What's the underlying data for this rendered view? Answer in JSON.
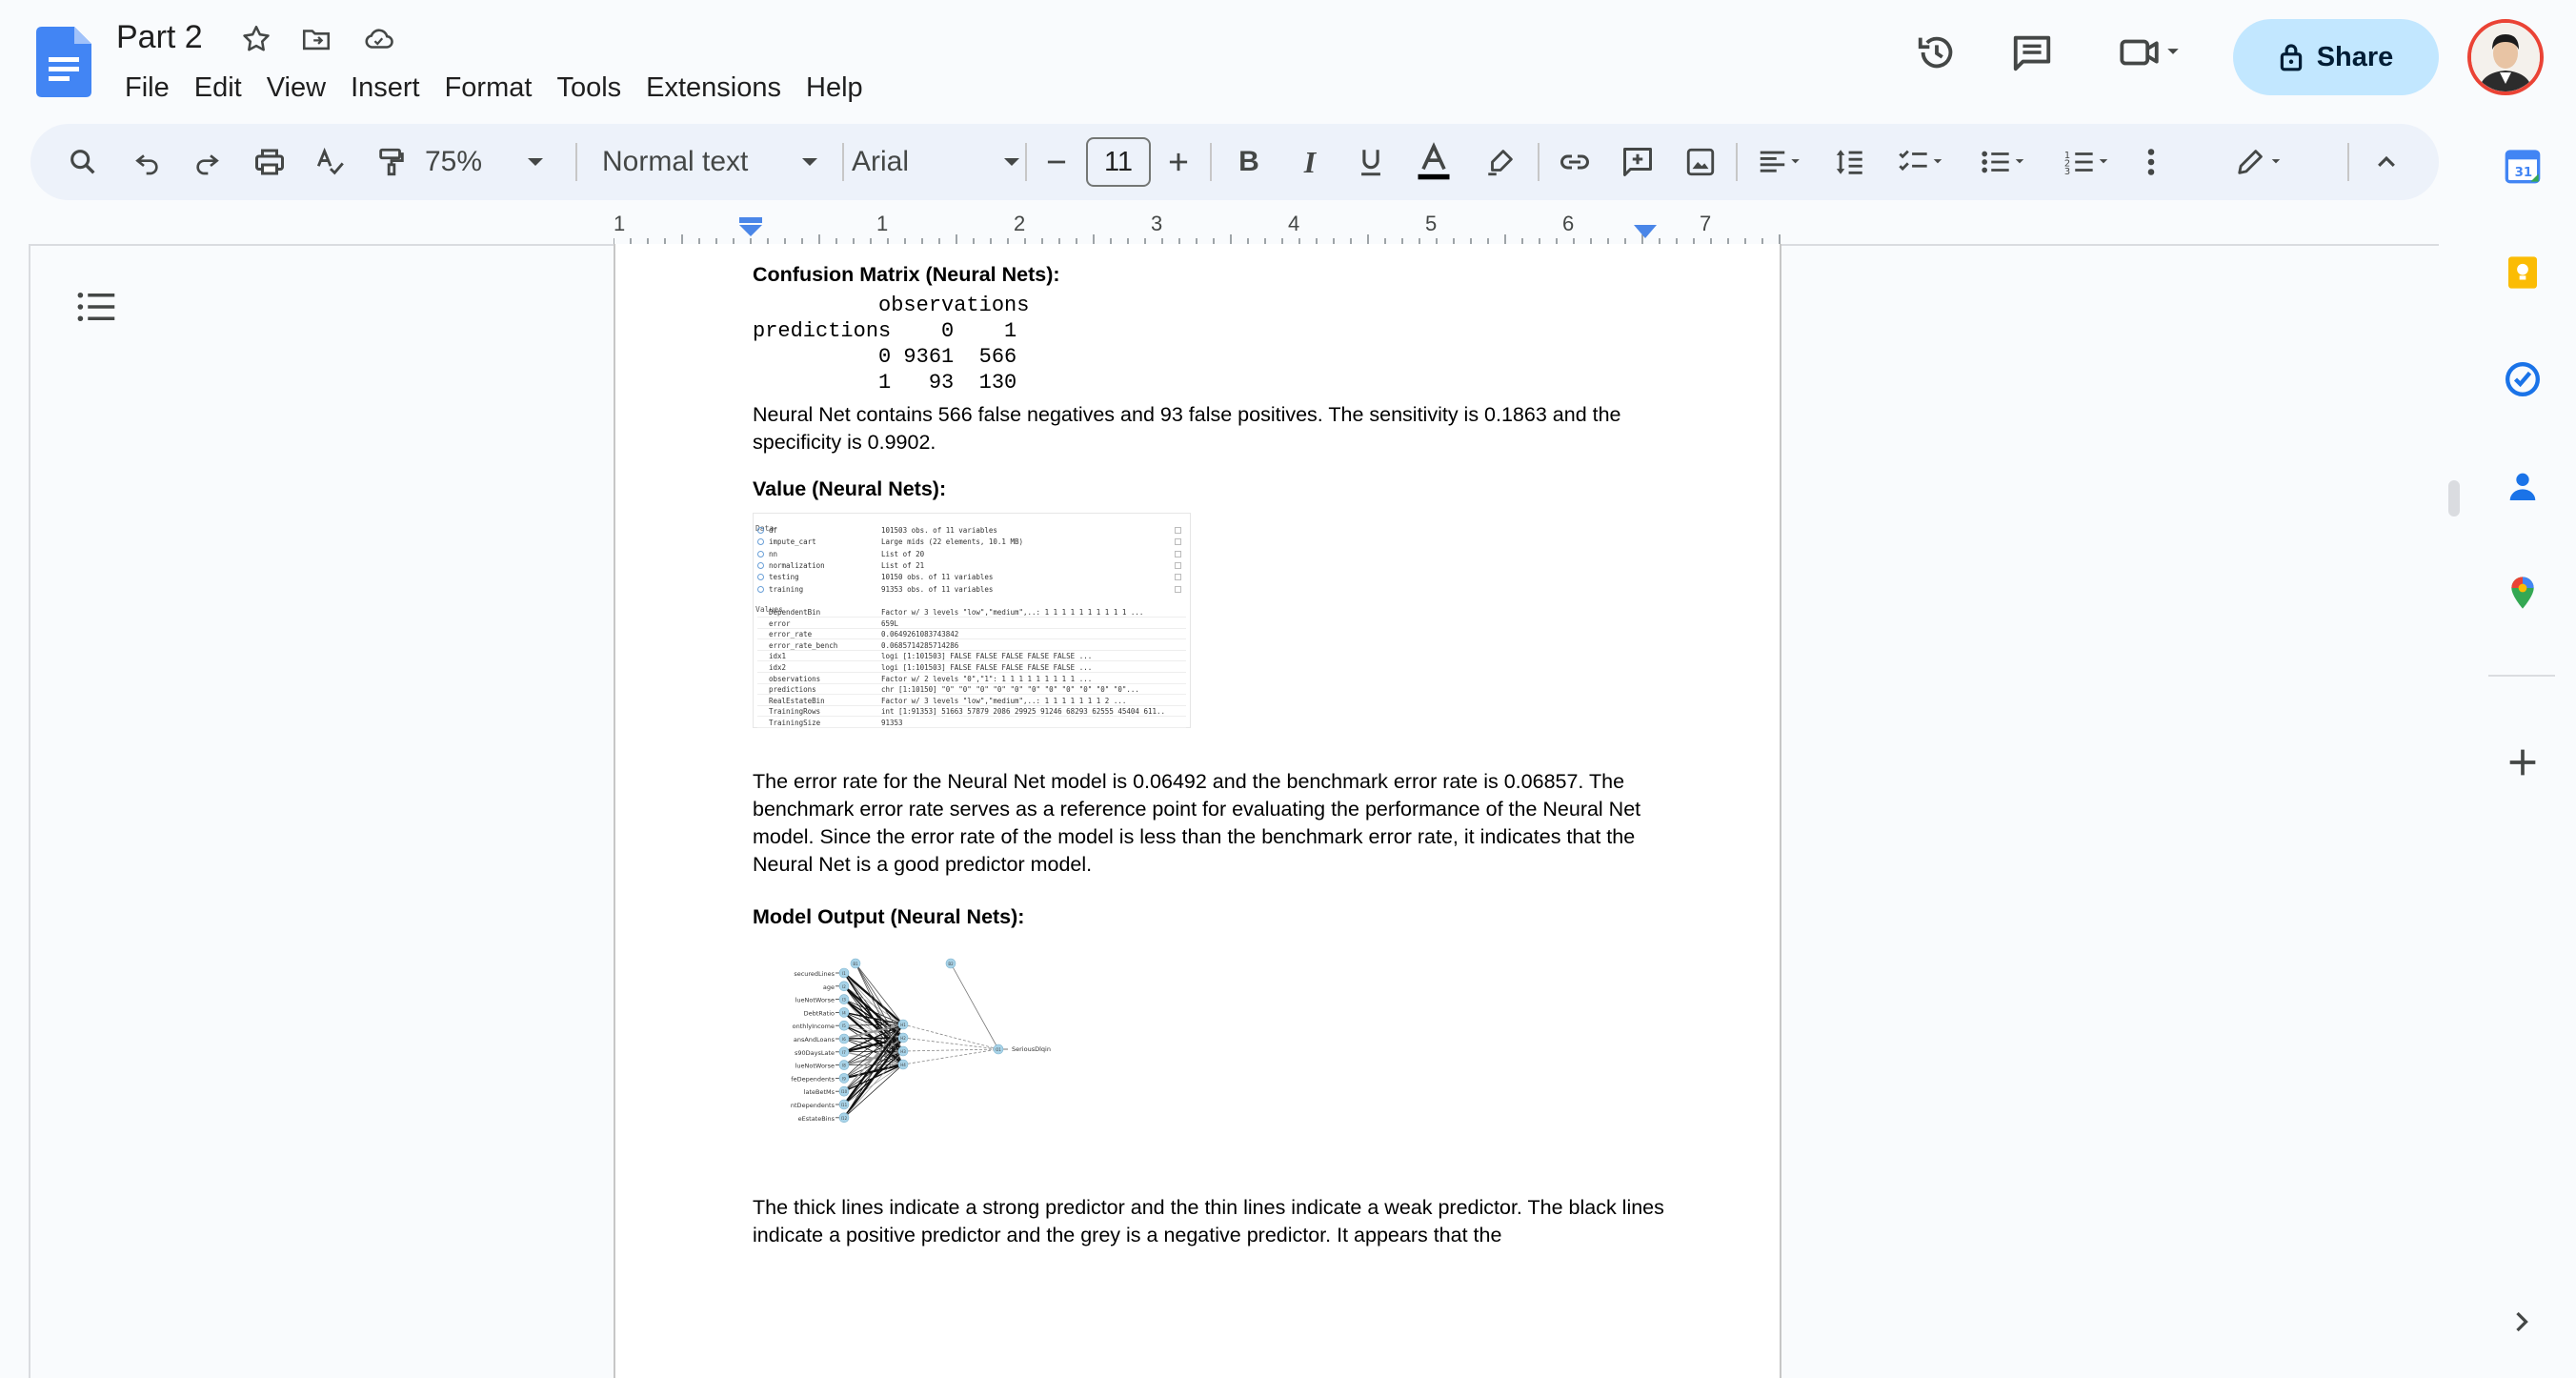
{
  "doc": {
    "title": "Part 2"
  },
  "menu": [
    "File",
    "Edit",
    "View",
    "Insert",
    "Format",
    "Tools",
    "Extensions",
    "Help"
  ],
  "share": {
    "label": "Share"
  },
  "toolbar": {
    "zoom": "75%",
    "style": "Normal text",
    "font": "Arial",
    "font_size": "11"
  },
  "ruler": {
    "numbers": [
      "1",
      "1",
      "2",
      "3",
      "4",
      "5",
      "6",
      "7"
    ]
  },
  "content": {
    "h1": "Confusion Matrix (Neural Nets):",
    "matrix_lines": [
      "          observations",
      "predictions    0    1",
      "          0 9361  566",
      "          1   93  130"
    ],
    "p1": "Neural Net contains 566 false negatives and 93 false positives. The sensitivity is 0.1863 and the specificity is 0.9902.",
    "h2": "Value (Neural Nets):",
    "env": {
      "data_header": "Data",
      "data_rows": [
        {
          "k": "df",
          "v": "101503 obs. of 11 variables"
        },
        {
          "k": "impute_cart",
          "v": "Large mids (22 elements,  10.1 MB)"
        },
        {
          "k": "nn",
          "v": "List of  20"
        },
        {
          "k": "normalization",
          "v": "List of  21"
        },
        {
          "k": "testing",
          "v": "10150 obs. of 11 variables"
        },
        {
          "k": "training",
          "v": "91353 obs. of 11 variables"
        }
      ],
      "values_header": "Values",
      "value_rows": [
        {
          "k": "DependentBin",
          "v": "Factor w/ 3 levels \"low\",\"medium\",..: 1 1 1 1 1 1 1 1 1 1 ..."
        },
        {
          "k": "error",
          "v": "659L"
        },
        {
          "k": "error_rate",
          "v": "0.0649261083743842"
        },
        {
          "k": "error_rate_bench",
          "v": "0.0685714285714286"
        },
        {
          "k": "idx1",
          "v": "logi [1:101503] FALSE FALSE FALSE FALSE FALSE ..."
        },
        {
          "k": "idx2",
          "v": "logi [1:101503] FALSE FALSE FALSE FALSE FALSE ..."
        },
        {
          "k": "observations",
          "v": "Factor w/ 2 levels \"0\",\"1\": 1 1 1 1 1 1 1 1 1 ..."
        },
        {
          "k": "predictions",
          "v": "chr [1:10150] \"0\" \"0\" \"0\" \"0\" \"0\" \"0\" \"0\" \"0\" \"0\" \"0\" \"0\"..."
        },
        {
          "k": "RealEstateBin",
          "v": "Factor w/ 3 levels \"low\",\"medium\",..: 1 1 1 1 1 1 1 2 ..."
        },
        {
          "k": "TrainingRows",
          "v": "int [1:91353] 51663 57879 2086 29925 91246 68293 62555 45404 611.."
        },
        {
          "k": "TrainingSize",
          "v": "91353"
        }
      ]
    },
    "p2": "The error rate for the Neural Net model is 0.06492 and the benchmark error rate is 0.06857. The benchmark error rate serves as a reference point for evaluating the performance of the Neural Net model. Since the error rate of the model is less than the benchmark error rate, it indicates that the Neural Net is a good predictor model.",
    "h3": "Model Output (Neural Nets):",
    "nn": {
      "inputs": [
        "securedLines",
        "age",
        "lueNotWorse",
        "DebtRatio",
        "onthlyIncome",
        "ansAndLoans",
        "s90DaysLate",
        "lueNotWorse",
        "feDependents",
        "lateBetMs",
        "ntDependents",
        "eEstateBins"
      ],
      "input_nodes": [
        "I1",
        "I2",
        "I3",
        "I4",
        "I5",
        "I6",
        "I7",
        "I8",
        "I9",
        "I10",
        "I11",
        "I12"
      ],
      "hidden_nodes": [
        "H1",
        "H2",
        "H3",
        "H4"
      ],
      "bias": [
        "B1",
        "B2"
      ],
      "output_node": "O1",
      "output_label": "SeriousDlqin"
    },
    "p3": "The thick lines indicate a strong predictor and the thin lines indicate a weak predictor. The black lines indicate a positive predictor and the grey is a negative predictor. It appears that the"
  },
  "colors": {
    "share_bg": "#c2e7ff",
    "toolbar_bg": "#edf2fa",
    "docs_blue": "#4285f4",
    "ruler_marker": "#4a86e8"
  }
}
